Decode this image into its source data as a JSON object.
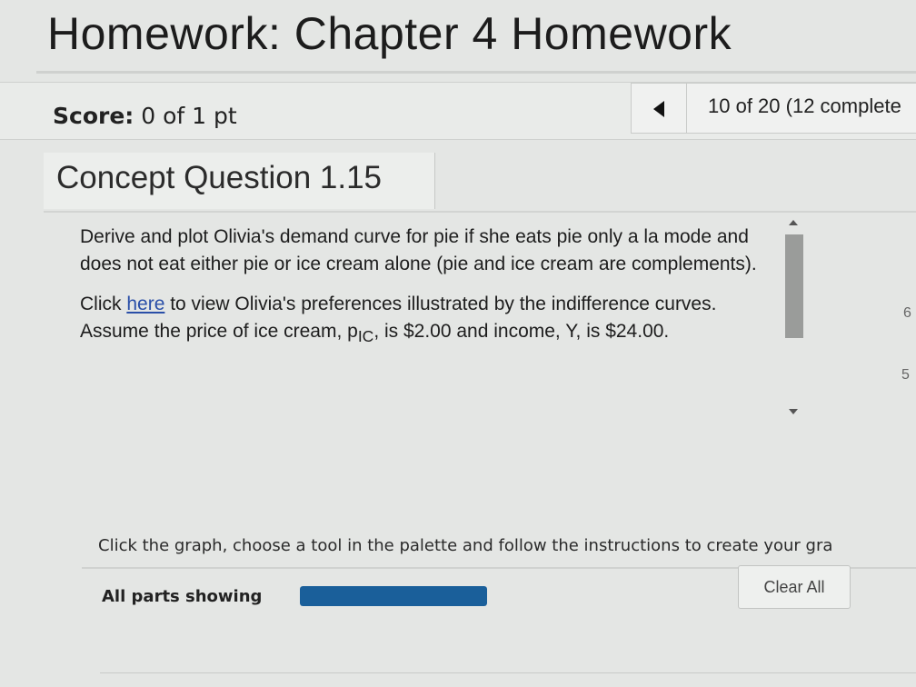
{
  "header": {
    "title": "Homework: Chapter 4 Homework"
  },
  "score_bar": {
    "score_label": "Score:",
    "score_value": "0 of 1 pt",
    "progress_text": "10 of 20 (12 complete"
  },
  "question": {
    "title": "Concept Question 1.15",
    "paragraph1": "Derive and plot Olivia's demand curve for pie if she eats pie only a la mode and does not eat either pie or ice cream alone (pie and ice cream are complements).",
    "p2_before_link": "Click ",
    "p2_link": "here",
    "p2_after_link": " to view Olivia's preferences illustrated by the indifference curves. Assume the price of ice cream, ",
    "price_symbol": "p",
    "price_subscript": "IC",
    "p2_after_price": ", is $2.00 and income, Y, is $24.00."
  },
  "edge_glyphs": {
    "e1": "6",
    "e2": "5"
  },
  "graph_instruction": "Click the graph, choose a tool in the palette and follow the instructions to create your gra",
  "footer": {
    "parts_label": "All parts showing",
    "progress_fraction": 1.0,
    "clear_label": "Clear All"
  }
}
